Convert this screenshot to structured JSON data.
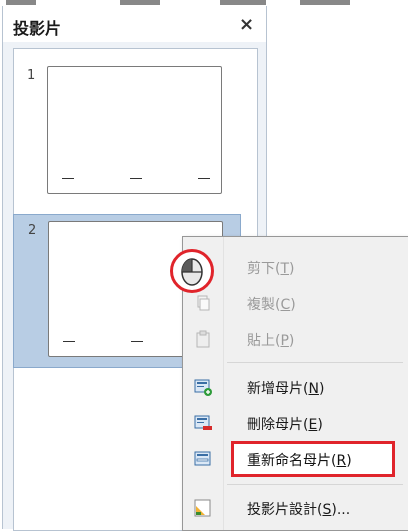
{
  "panel": {
    "title": "投影片",
    "close": "×"
  },
  "slides": [
    {
      "number": "1",
      "selected": false
    },
    {
      "number": "2",
      "selected": true
    }
  ],
  "context_menu": {
    "items": [
      {
        "label": "剪下(T)",
        "text": "剪下(",
        "key": "T",
        "end": ")",
        "enabled": false,
        "icon": "cut-icon"
      },
      {
        "label": "複製(C)",
        "text": "複製(",
        "key": "C",
        "end": ")",
        "enabled": false,
        "icon": "copy-icon"
      },
      {
        "label": "貼上(P)",
        "text": "貼上(",
        "key": "P",
        "end": ")",
        "enabled": false,
        "icon": "paste-icon"
      },
      {
        "label": "新增母片(N)",
        "text": "新增母片(",
        "key": "N",
        "end": ")",
        "enabled": true,
        "icon": "new-master-icon"
      },
      {
        "label": "刪除母片(E)",
        "text": "刪除母片(",
        "key": "E",
        "end": ")",
        "enabled": true,
        "icon": "delete-master-icon"
      },
      {
        "label": "重新命名母片(R)",
        "text": "重新命名母片(",
        "key": "R",
        "end": ")",
        "enabled": true,
        "highlighted": true,
        "icon": "rename-master-icon"
      },
      {
        "label": "投影片設計(S)...",
        "text": "投影片設計(",
        "key": "S",
        "end": ")...",
        "enabled": true,
        "icon": "slide-design-icon"
      }
    ]
  },
  "colors": {
    "highlight": "#e0242b",
    "selection": "#b8cde4"
  }
}
